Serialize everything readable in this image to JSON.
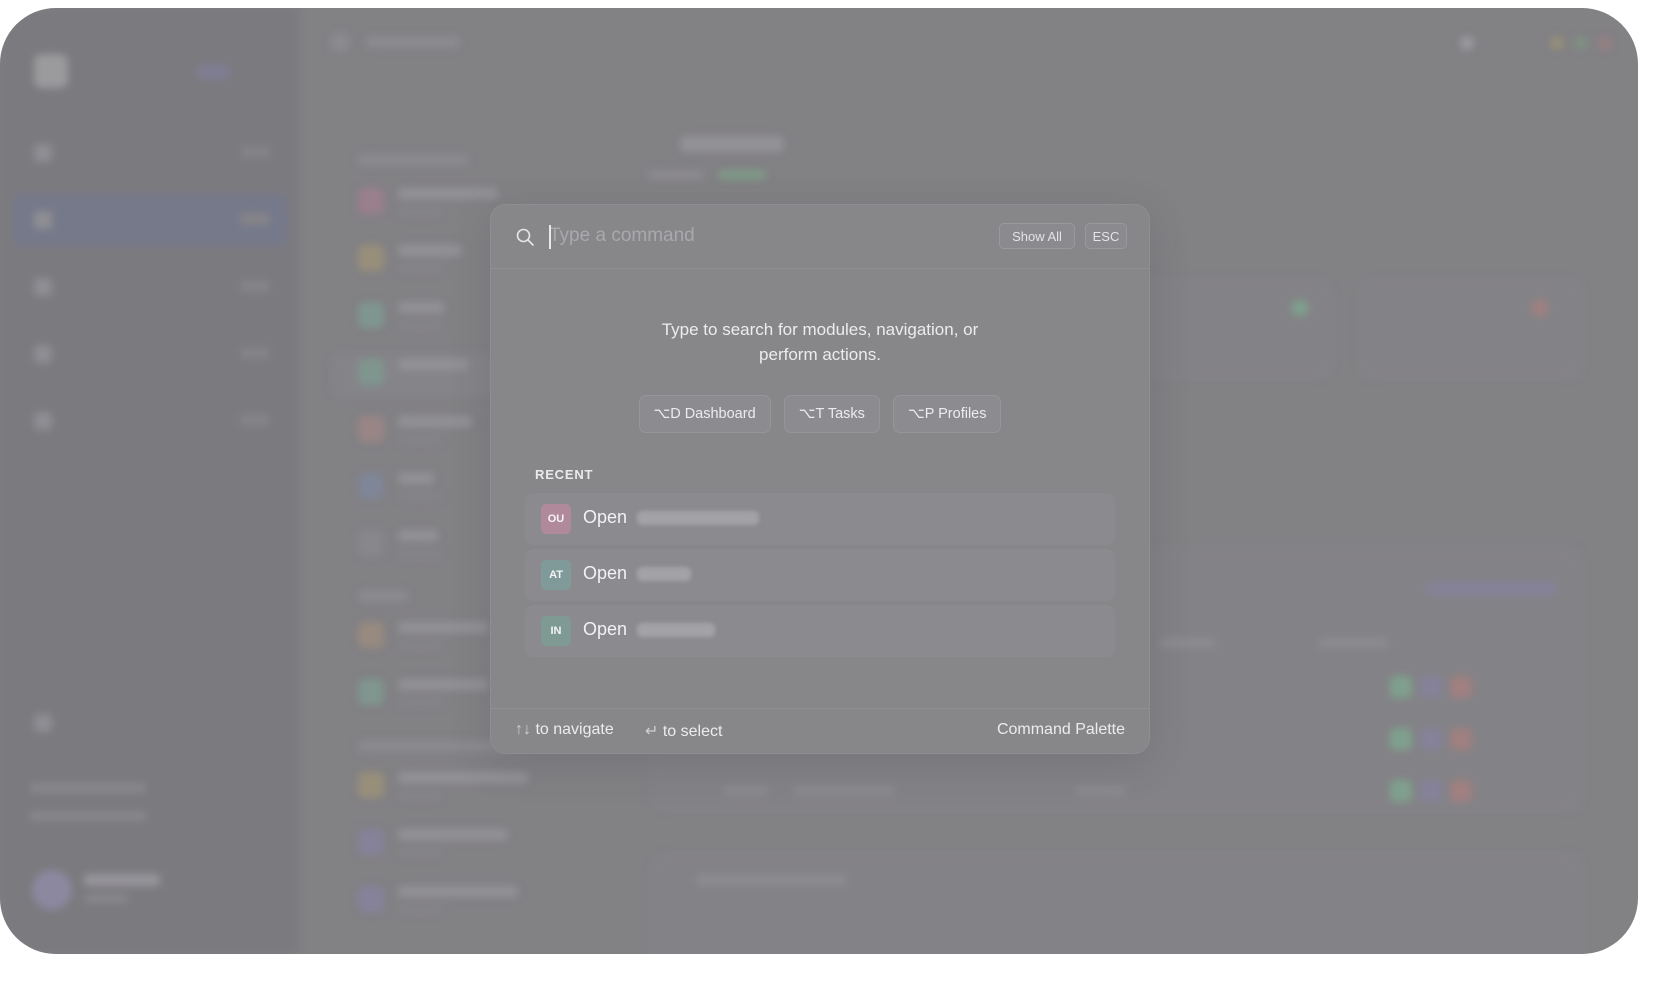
{
  "palette": {
    "search_placeholder": "Type a command",
    "show_all_label": "Show All",
    "esc_label": "ESC",
    "hint_line1": "Type to search for modules, navigation, or",
    "hint_line2": "perform actions.",
    "shortcuts": [
      {
        "label": "⌥D Dashboard"
      },
      {
        "label": "⌥T Tasks"
      },
      {
        "label": "⌥P Profiles"
      }
    ],
    "recent_label": "RECENT",
    "recent": [
      {
        "initials": "OU",
        "verb": "Open",
        "color": "#b0899a"
      },
      {
        "initials": "AT",
        "verb": "Open",
        "color": "#7f9a98"
      },
      {
        "initials": "IN",
        "verb": "Open",
        "color": "#7f9a92"
      }
    ],
    "footer": {
      "navigate_arrows": "↑↓",
      "navigate_label": "to navigate",
      "select_arrow": "↵",
      "select_label": "to select",
      "title": "Command Palette"
    }
  },
  "colors": {
    "overlay": "#828184",
    "accent_green": "#7fa08c",
    "accent_purple": "#8c88a0",
    "accent_red": "#a08080"
  },
  "icons": {
    "search": "search-icon"
  }
}
